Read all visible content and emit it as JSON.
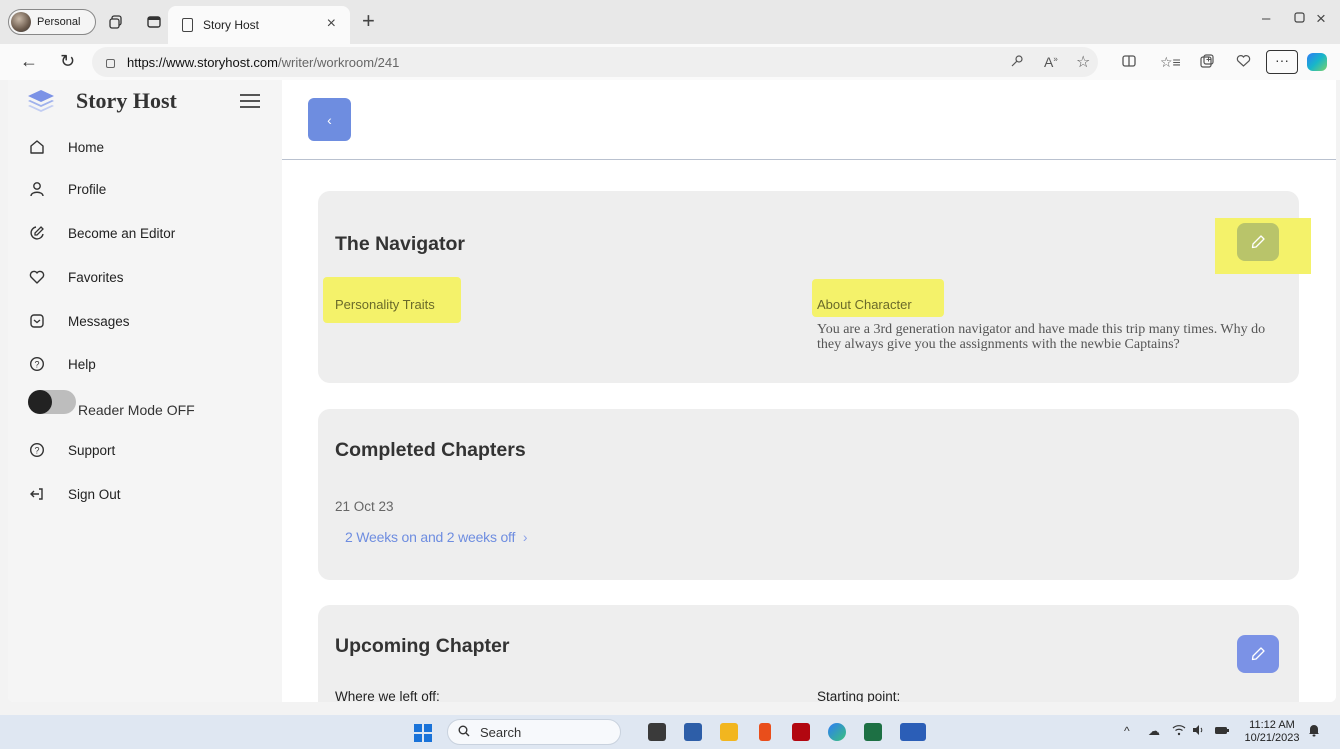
{
  "browser": {
    "profile_label": "Personal",
    "tab_title": "Story Host",
    "url_host": "https://www.storyhost.com",
    "url_path": "/writer/workroom/241",
    "menu_label": "···"
  },
  "sidebar": {
    "brand": "Story Host",
    "items": [
      {
        "label": "Home",
        "icon": "home-icon"
      },
      {
        "label": "Profile",
        "icon": "user-icon"
      },
      {
        "label": "Become an Editor",
        "icon": "edit-circle-icon"
      },
      {
        "label": "Favorites",
        "icon": "heart-icon"
      },
      {
        "label": "Messages",
        "icon": "message-icon"
      },
      {
        "label": "Help",
        "icon": "help-icon"
      }
    ],
    "reader_mode_label": "Reader Mode OFF",
    "items_bottom": [
      {
        "label": "Support",
        "icon": "help-icon"
      },
      {
        "label": "Sign Out",
        "icon": "sign-out-icon"
      }
    ]
  },
  "main": {
    "back_label": "‹",
    "character_card": {
      "title": "The Navigator",
      "personality_label": "Personality Traits",
      "about_label": "About Character",
      "about_text": "You are a 3rd generation navigator and have made this trip many times. Why do they always give you the assignments with the newbie Captains?"
    },
    "completed_card": {
      "title": "Completed Chapters",
      "date": "21 Oct 23",
      "chapter_link": "2 Weeks on and 2 weeks off",
      "chevron": "›"
    },
    "upcoming_card": {
      "title": "Upcoming Chapter",
      "left_label": "Where we left off:",
      "right_label": "Starting point:"
    }
  },
  "taskbar": {
    "search_label": "Search",
    "time": "11:12 AM",
    "date": "10/21/2023"
  },
  "colors": {
    "accent": "#6e8de0",
    "highlight": "#f4f26a",
    "card_bg": "#eeeeee"
  }
}
